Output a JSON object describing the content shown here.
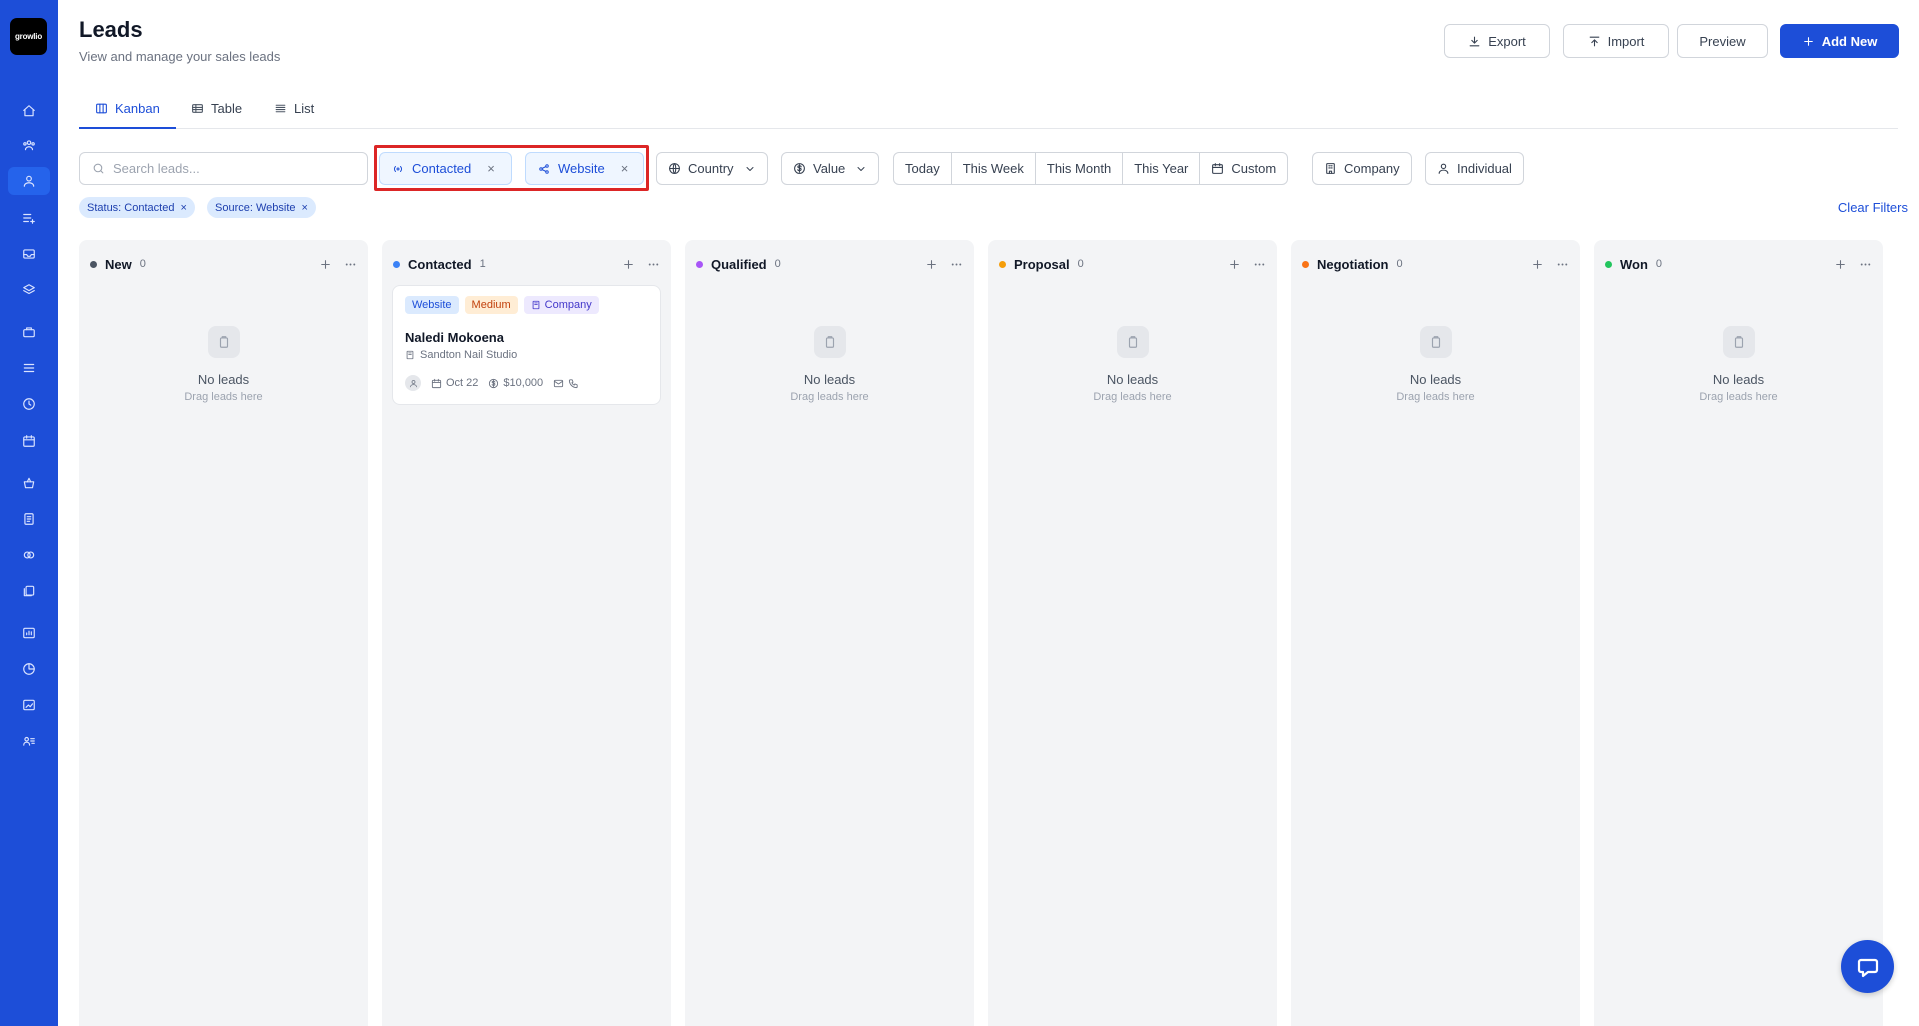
{
  "app": {
    "logo_text": "growlio"
  },
  "sidebar": {
    "items": [
      {
        "icon": "home-icon"
      },
      {
        "icon": "users-group-icon"
      },
      {
        "icon": "user-icon",
        "active": true
      },
      {
        "icon": "list-plus-icon"
      },
      {
        "icon": "inbox-icon"
      },
      {
        "icon": "layers-icon"
      },
      {
        "icon": "briefcase-icon"
      },
      {
        "icon": "menu-icon"
      },
      {
        "icon": "clock-icon"
      },
      {
        "icon": "calendar-icon"
      },
      {
        "icon": "basket-icon"
      },
      {
        "icon": "receipt-icon"
      },
      {
        "icon": "coins-icon"
      },
      {
        "icon": "documents-icon"
      },
      {
        "icon": "chart-box-icon"
      },
      {
        "icon": "pie-chart-icon"
      },
      {
        "icon": "report-icon"
      },
      {
        "icon": "user-list-icon"
      }
    ]
  },
  "header": {
    "title": "Leads",
    "subtitle": "View and manage your sales leads",
    "export_label": "Export",
    "import_label": "Import",
    "preview_label": "Preview",
    "add_new_label": "Add New"
  },
  "tabs": [
    {
      "label": "Kanban",
      "icon": "kanban-icon",
      "active": true
    },
    {
      "label": "Table",
      "icon": "table-icon"
    },
    {
      "label": "List",
      "icon": "list-icon"
    }
  ],
  "filters": {
    "search_placeholder": "Search leads...",
    "search_value": "",
    "status_chip": "Contacted",
    "source_chip": "Website",
    "country_label": "Country",
    "value_label": "Value",
    "date_options": [
      "Today",
      "This Week",
      "This Month",
      "This Year"
    ],
    "custom_label": "Custom",
    "company_label": "Company",
    "individual_label": "Individual"
  },
  "applied_tags": [
    {
      "label": "Status: Contacted"
    },
    {
      "label": "Source: Website"
    }
  ],
  "clear_filters_label": "Clear Filters",
  "columns": [
    {
      "title": "New",
      "count": "0",
      "color": "#4b5563"
    },
    {
      "title": "Contacted",
      "count": "1",
      "color": "#3b82f6"
    },
    {
      "title": "Qualified",
      "count": "0",
      "color": "#a855f7"
    },
    {
      "title": "Proposal",
      "count": "0",
      "color": "#f59e0b"
    },
    {
      "title": "Negotiation",
      "count": "0",
      "color": "#f97316"
    },
    {
      "title": "Won",
      "count": "0",
      "color": "#22c55e"
    }
  ],
  "empty_state": {
    "title": "No leads",
    "subtitle": "Drag leads here"
  },
  "lead_card": {
    "source_badge": "Website",
    "priority_badge": "Medium",
    "type_badge": "Company",
    "name": "Naledi Mokoena",
    "company": "Sandton Nail Studio",
    "date": "Oct 22",
    "value": "$10,000"
  }
}
